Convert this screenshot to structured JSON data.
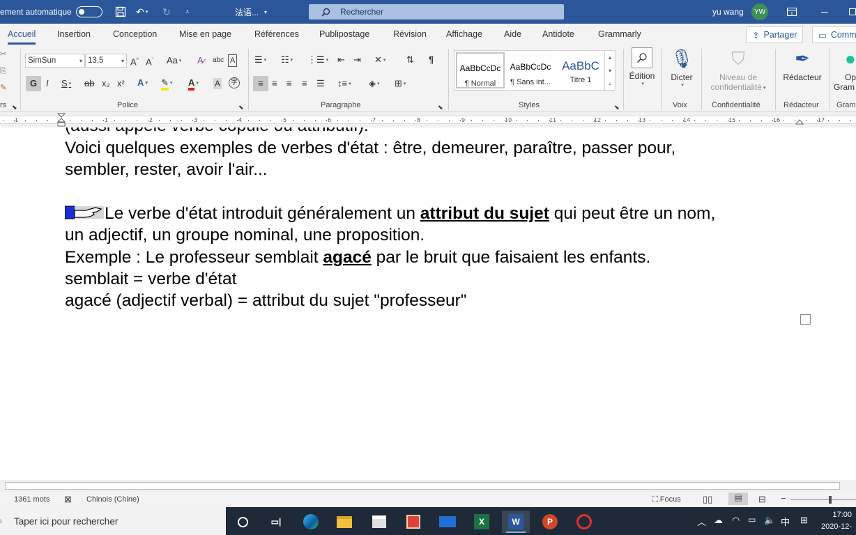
{
  "titlebar": {
    "autosave_label": "ement automatique",
    "doc_title": "法语...",
    "search_label": "Rechercher",
    "user_name": "yu wang",
    "user_initials": "YW"
  },
  "tabs": [
    "Accueil",
    "Insertion",
    "Conception",
    "Mise en page",
    "Références",
    "Publipostage",
    "Révision",
    "Affichage",
    "Aide",
    "Antidote",
    "Grammarly"
  ],
  "share_label": "Partager",
  "comments_label": "Comm",
  "ribbon": {
    "clipboard_label": "rs",
    "font_name": "SimSun",
    "font_size": "13,5",
    "case_label": "Aa",
    "bold": "G",
    "italic": "I",
    "underline": "S",
    "strike": "ab",
    "subscript": "x₂",
    "superscript": "x²",
    "font_group": "Police",
    "para_group": "Paragraphe",
    "styles_group": "Styles",
    "styles": [
      {
        "preview": "AaBbCcDc",
        "name": "¶ Normal"
      },
      {
        "preview": "AaBbCcDc",
        "name": "¶ Sans int..."
      },
      {
        "preview": "AaBbC",
        "name": "Titre 1"
      }
    ],
    "edition_label": "Édition",
    "dicter_label": "Dicter",
    "voix_group": "Voix",
    "confid_label_1": "Niveau de",
    "confid_label_2": "confidentialité",
    "confid_group": "Confidentialité",
    "redacteur_label": "Rédacteur",
    "redacteur_group": "Rédacteur",
    "gram_label_1": "Op",
    "gram_label_2": "Gram",
    "gram_group": "Gram"
  },
  "ruler": {
    "numbers": [
      "1",
      "1",
      "2",
      "3",
      "4",
      "5",
      "6",
      "7",
      "8",
      "9",
      "10",
      "11",
      "12",
      "13",
      "14",
      "15",
      "16",
      "17"
    ]
  },
  "document": {
    "line0": "(aussi appelé verbe copule ou attributif).",
    "line1": "Voici quelques exemples de verbes d'état : être, demeurer, paraître, passer pour,",
    "line2": "sembler, rester, avoir l'air...",
    "line3_a": "Le verbe d'état introduit généralement un ",
    "line3_b": "attribut du sujet",
    "line3_c": " qui peut être un nom,",
    "line4": "un adjectif, un groupe nominal, une proposition.",
    "line5_a": "Exemple : Le professeur semblait ",
    "line5_b": "agacé",
    "line5_c": " par le bruit que faisaient les enfants.",
    "line6": "semblait = verbe d'état",
    "line7": "agacé (adjectif verbal) = attribut du sujet \"professeur\""
  },
  "status": {
    "word_count": "1361 mots",
    "language": "Chinois (Chine)",
    "focus": "Focus"
  },
  "taskbar": {
    "search_placeholder": "Taper ici pour rechercher",
    "time": "17:00",
    "date": "2020-12-",
    "ime": "中"
  },
  "colors": {
    "title_blue": "#2b579a",
    "ribbon_bg": "#f3f3f3",
    "taskbar_bg": "#1f2a38"
  }
}
